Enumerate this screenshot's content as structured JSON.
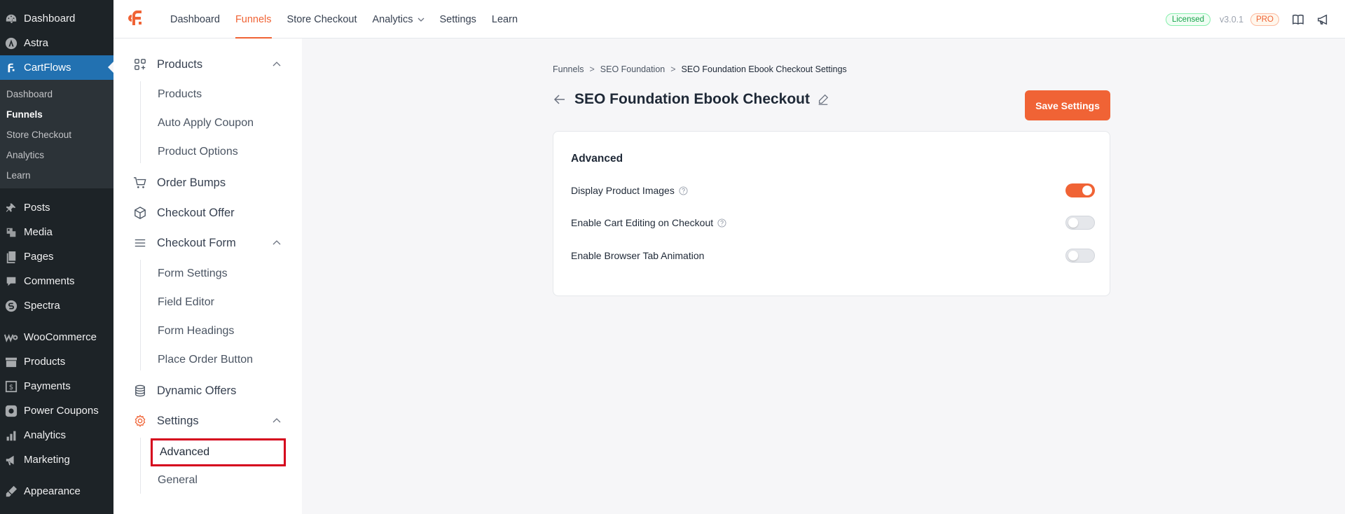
{
  "wp_sidebar": {
    "items_top": [
      {
        "label": "Dashboard",
        "icon": "dashboard-icon"
      },
      {
        "label": "Astra",
        "icon": "astra-icon"
      },
      {
        "label": "CartFlows",
        "icon": "cartflows-icon"
      }
    ],
    "submenu": [
      "Dashboard",
      "Funnels",
      "Store Checkout",
      "Analytics",
      "Learn"
    ],
    "items_bottom": [
      {
        "label": "Posts",
        "icon": "pin-icon"
      },
      {
        "label": "Media",
        "icon": "media-icon"
      },
      {
        "label": "Pages",
        "icon": "pages-icon"
      },
      {
        "label": "Comments",
        "icon": "comments-icon"
      },
      {
        "label": "Spectra",
        "icon": "spectra-icon"
      },
      {
        "label": "WooCommerce",
        "icon": "woocommerce-icon"
      },
      {
        "label": "Products",
        "icon": "products-icon"
      },
      {
        "label": "Payments",
        "icon": "payments-icon"
      },
      {
        "label": "Power Coupons",
        "icon": "coupons-icon"
      },
      {
        "label": "Analytics",
        "icon": "analytics-icon"
      },
      {
        "label": "Marketing",
        "icon": "marketing-icon"
      },
      {
        "label": "Appearance",
        "icon": "appearance-icon"
      }
    ]
  },
  "topnav": {
    "items": [
      "Dashboard",
      "Funnels",
      "Store Checkout",
      "Analytics",
      "Settings",
      "Learn"
    ],
    "licensed": "Licensed",
    "version": "v3.0.1",
    "pro": "PRO"
  },
  "settings_nav": {
    "products": "Products",
    "products_sub": [
      "Products",
      "Auto Apply Coupon",
      "Product Options"
    ],
    "order_bumps": "Order Bumps",
    "checkout_offer": "Checkout Offer",
    "checkout_form": "Checkout Form",
    "checkout_form_sub": [
      "Form Settings",
      "Field Editor",
      "Form Headings",
      "Place Order Button"
    ],
    "dynamic_offers": "Dynamic Offers",
    "settings": "Settings",
    "settings_sub": [
      "Advanced",
      "General"
    ]
  },
  "breadcrumb": [
    "Funnels",
    "SEO Foundation",
    "SEO Foundation Ebook Checkout Settings"
  ],
  "page_title": "SEO Foundation Ebook Checkout",
  "save_label": "Save Settings",
  "card": {
    "title": "Advanced",
    "settings": [
      {
        "label": "Display Product Images",
        "help": true,
        "enabled": true
      },
      {
        "label": "Enable Cart Editing on Checkout",
        "help": true,
        "enabled": false
      },
      {
        "label": "Enable Browser Tab Animation",
        "help": false,
        "enabled": false
      }
    ]
  },
  "colors": {
    "accent": "#f06335",
    "wp_sidebar": "#1d2327",
    "wp_active": "#2271b1",
    "highlight_border": "#d5001c"
  }
}
